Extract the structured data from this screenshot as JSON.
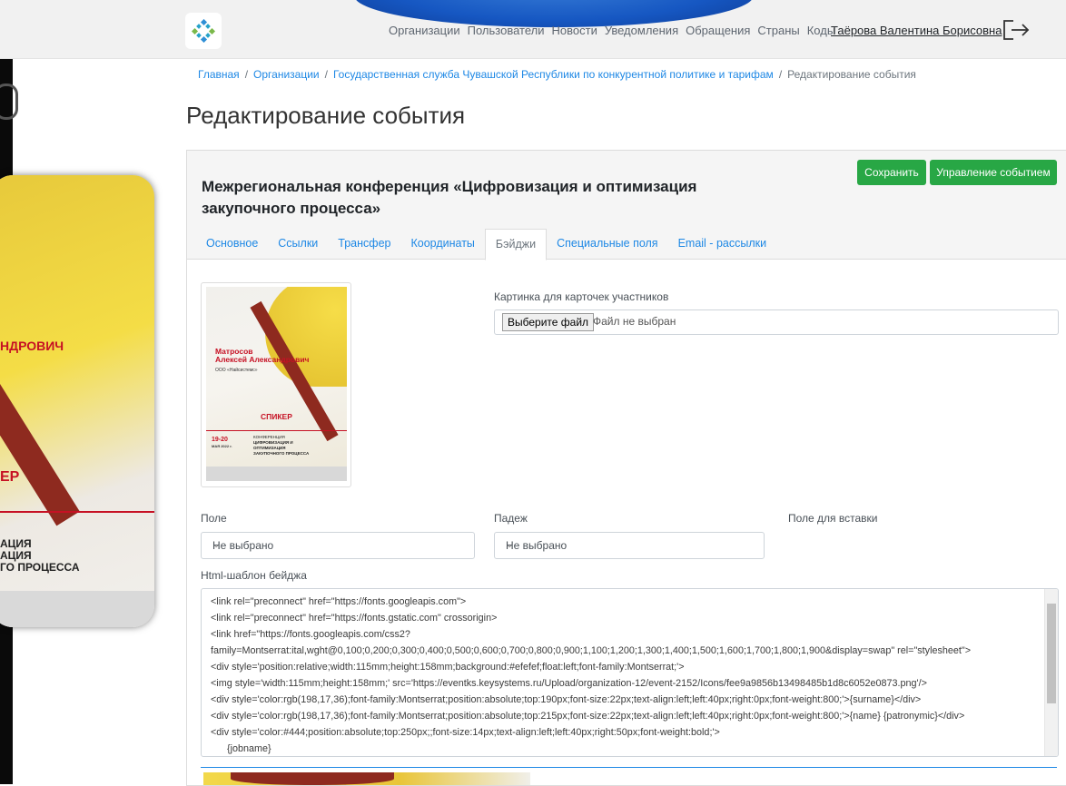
{
  "nav": {
    "links": [
      "Организации",
      "Пользователи",
      "Новости",
      "Уведомления",
      "Обращения",
      "Страны",
      "Коды"
    ],
    "user_name": "Таёрова Валентина Борисовна"
  },
  "breadcrumb": {
    "home": "Главная",
    "organizations": "Организации",
    "organization": "Государственная служба Чувашской Республики по конкурентной политике и тарифам",
    "current": "Редактирование события"
  },
  "page_title": "Редактирование события",
  "event": {
    "title": "Межрегиональная конференция «Цифровизация и оптимизация закупочного процесса»",
    "save_label": "Сохранить",
    "manage_label": "Управление событием"
  },
  "tabs": [
    {
      "label": "Основное",
      "active": false
    },
    {
      "label": "Ссылки",
      "active": false
    },
    {
      "label": "Трансфер",
      "active": false
    },
    {
      "label": "Координаты",
      "active": false
    },
    {
      "label": "Бэйджи",
      "active": true
    },
    {
      "label": "Специальные поля",
      "active": false
    },
    {
      "label": "Email - рассылки",
      "active": false
    }
  ],
  "badge_preview": {
    "surname": "Матросов",
    "name_line": "Алексей Александрович",
    "org": "ООО «Найсистемс»",
    "role": "СПИКЕР",
    "dates": "19-20",
    "month": "МАЯ 2022 г.",
    "conf_kind": "КОНФЕРЕНЦИЯ",
    "conf_title": "ЦИФРОВИЗАЦИЯ И ОПТИМИЗАЦИЯ ЗАКУПОЧНОГО ПРОЦЕССА"
  },
  "left_badge": {
    "name_fragment": "НДРОВИЧ",
    "role_fragment": "ЕР",
    "conf_fragment": "АЦИЯ\nАЦИЯ\nГО ПРОЦЕССА"
  },
  "form": {
    "image_label": "Картинка для карточек участников",
    "file_button": "Выберите файл",
    "file_status": "Файл не выбран",
    "field_label": "Поле",
    "field_value": "Не выбрано",
    "case_label": "Падеж",
    "case_value": "Не выбрано",
    "insert_label": "Поле для вставки",
    "template_label": "Html-шаблон бейджа",
    "template_lines": [
      "<link rel=\"preconnect\" href=\"https://fonts.googleapis.com\">",
      "<link rel=\"preconnect\" href=\"https://fonts.gstatic.com\" crossorigin>",
      "<link href=\"https://fonts.googleapis.com/css2?",
      "family=Montserrat:ital,wght@0,100;0,200;0,300;0,400;0,500;0,600;0,700;0,800;0,900;1,100;1,200;1,300;1,400;1,500;1,600;1,700;1,800;1,900&display=swap\" rel=\"stylesheet\">",
      "<div style='position:relative;width:115mm;height:158mm;background:#efefef;float:left;font-family:Montserrat;'>",
      "<img style='width:115mm;height:158mm;' src='https://eventks.keysystems.ru/Upload/organization-12/event-2152/Icons/fee9a9856b13498485b1d8c6052e0873.png'/>",
      "<div style='color:rgb(198,17,36);font-family:Montserrat;position:absolute;top:190px;font-size:22px;text-align:left;left:40px;right:0px;font-weight:800;'>{surname}</div>",
      "<div style='color:rgb(198,17,36);font-family:Montserrat;position:absolute;top:215px;font-size:22px;text-align:left;left:40px;right:0px;font-weight:800;'>{name} {patronymic}</div>",
      "<div style='color:#444;position:absolute;top:250px;;font-size:14px;text-align:left;left:40px;right:50px;font-weight:bold;'>",
      "      {jobname}"
    ]
  }
}
